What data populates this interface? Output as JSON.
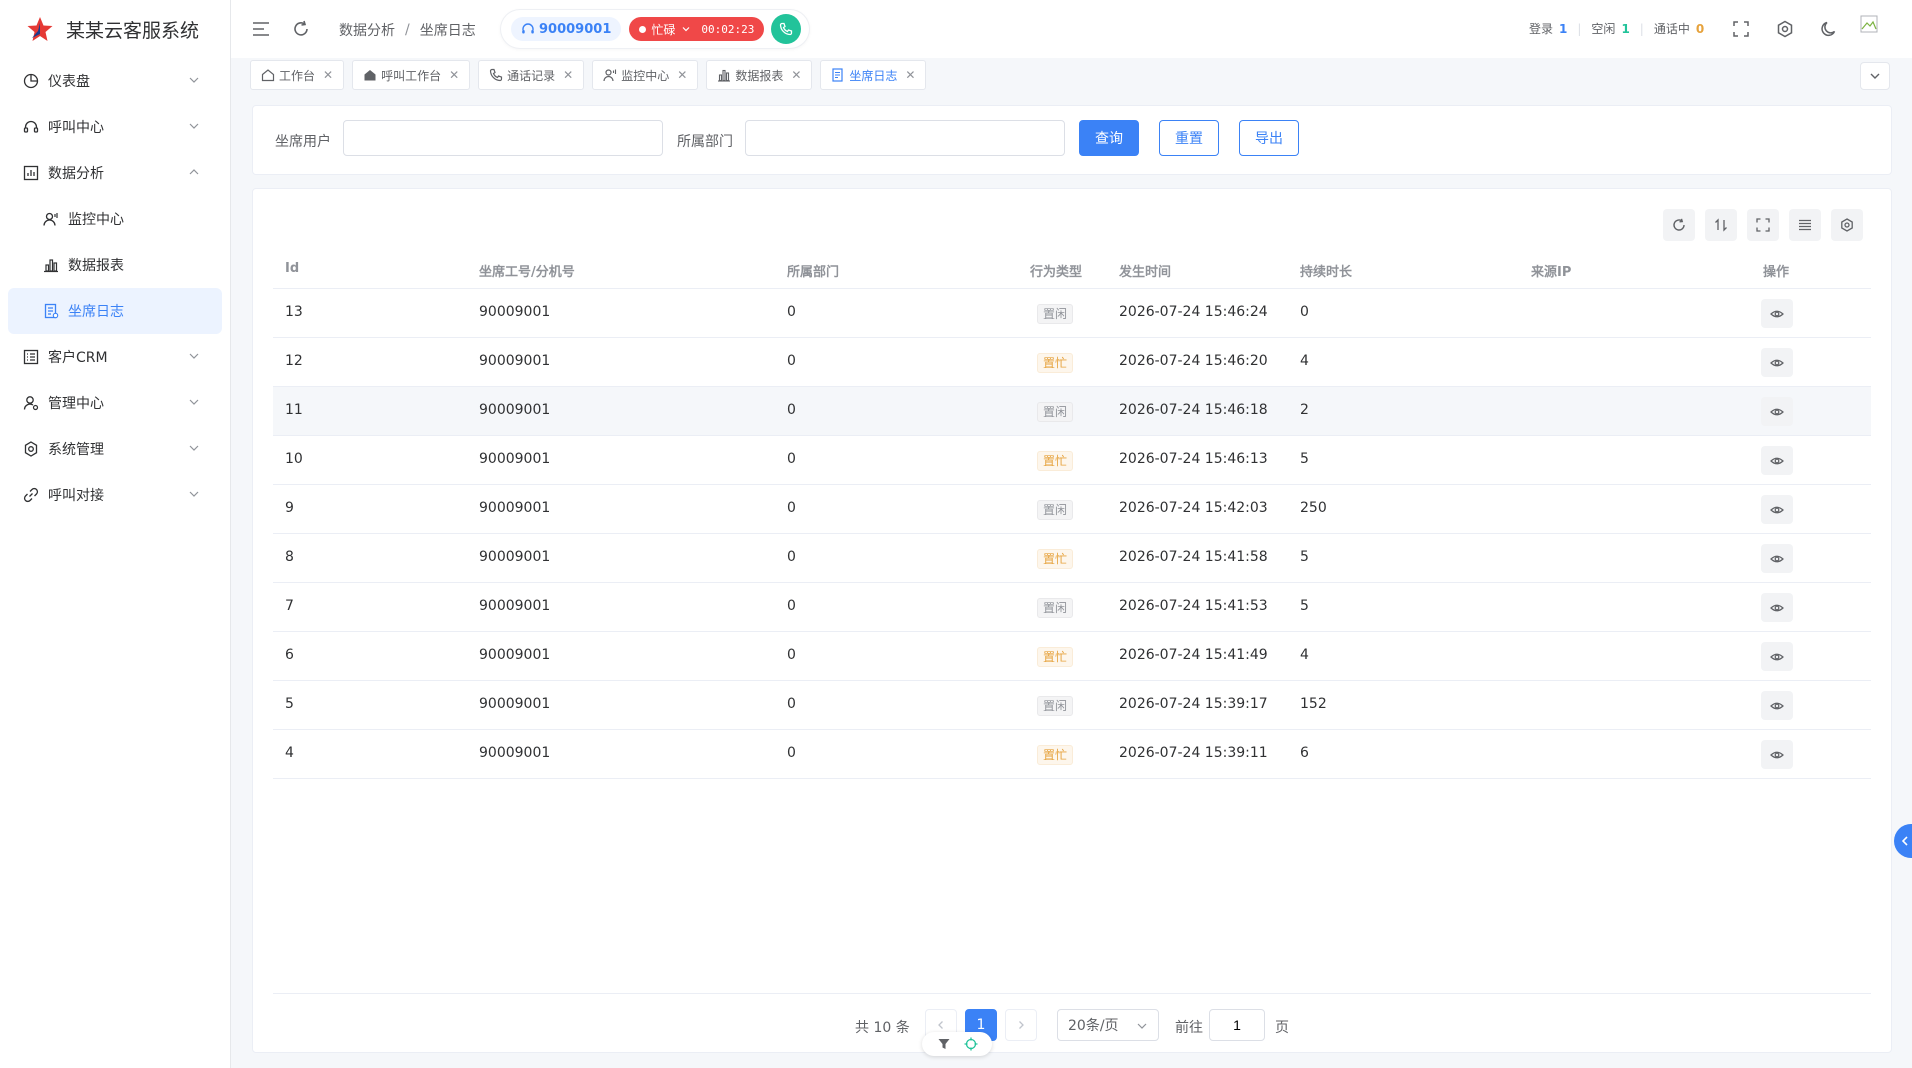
{
  "app": {
    "title": "某某云客服系统",
    "brand_color": "#e53935",
    "accent_color": "#3b82f6"
  },
  "sidebar": {
    "items": [
      {
        "label": "仪表盘",
        "icon": "pie-chart-icon",
        "expanded": false
      },
      {
        "label": "呼叫中心",
        "icon": "headset-icon",
        "expanded": false
      },
      {
        "label": "数据分析",
        "icon": "bar-chart-box-icon",
        "expanded": true
      },
      {
        "label": "客户CRM",
        "icon": "list-doc-icon",
        "expanded": false
      },
      {
        "label": "管理中心",
        "icon": "user-settings-icon",
        "expanded": false
      },
      {
        "label": "系统管理",
        "icon": "gear-icon",
        "expanded": false
      },
      {
        "label": "呼叫对接",
        "icon": "link-icon",
        "expanded": false
      }
    ],
    "subitems": [
      {
        "label": "监控中心",
        "icon": "monitor-user-icon"
      },
      {
        "label": "数据报表",
        "icon": "bar-chart-icon"
      },
      {
        "label": "坐席日志",
        "icon": "log-doc-icon",
        "active": true
      }
    ]
  },
  "header": {
    "breadcrumb": [
      "数据分析",
      "坐席日志"
    ],
    "extension": "90009001",
    "status": "忙碌",
    "timer": "00:02:23",
    "stats": {
      "login_label": "登录",
      "login_value": "1",
      "idle_label": "空闲",
      "idle_value": "1",
      "talking_label": "通话中",
      "talking_value": "0"
    }
  },
  "tabs": [
    {
      "label": "工作台",
      "icon": "home-icon",
      "active": false
    },
    {
      "label": "呼叫工作台",
      "icon": "home-fill-icon",
      "active": false
    },
    {
      "label": "通话记录",
      "icon": "phone-icon",
      "active": false
    },
    {
      "label": "监控中心",
      "icon": "monitor-user-icon",
      "active": false
    },
    {
      "label": "数据报表",
      "icon": "bar-chart-icon",
      "active": false
    },
    {
      "label": "坐席日志",
      "icon": "log-doc-icon",
      "active": true
    }
  ],
  "search": {
    "user_label": "坐席用户",
    "user_value": "",
    "dept_label": "所属部门",
    "dept_value": "",
    "query_label": "查询",
    "reset_label": "重置",
    "export_label": "导出"
  },
  "table": {
    "columns": [
      "Id",
      "坐席工号/分机号",
      "所属部门",
      "行为类型",
      "发生时间",
      "持续时长",
      "来源IP",
      "操作"
    ],
    "rows": [
      {
        "id": "13",
        "agent": "90009001",
        "dept": "0",
        "type": "置闲",
        "kind": "idle",
        "time": "2026-07-24 15:46:24",
        "duration": "0",
        "ip": ""
      },
      {
        "id": "12",
        "agent": "90009001",
        "dept": "0",
        "type": "置忙",
        "kind": "busy",
        "time": "2026-07-24 15:46:20",
        "duration": "4",
        "ip": ""
      },
      {
        "id": "11",
        "agent": "90009001",
        "dept": "0",
        "type": "置闲",
        "kind": "idle",
        "time": "2026-07-24 15:46:18",
        "duration": "2",
        "ip": ""
      },
      {
        "id": "10",
        "agent": "90009001",
        "dept": "0",
        "type": "置忙",
        "kind": "busy",
        "time": "2026-07-24 15:46:13",
        "duration": "5",
        "ip": ""
      },
      {
        "id": "9",
        "agent": "90009001",
        "dept": "0",
        "type": "置闲",
        "kind": "idle",
        "time": "2026-07-24 15:42:03",
        "duration": "250",
        "ip": ""
      },
      {
        "id": "8",
        "agent": "90009001",
        "dept": "0",
        "type": "置忙",
        "kind": "busy",
        "time": "2026-07-24 15:41:58",
        "duration": "5",
        "ip": ""
      },
      {
        "id": "7",
        "agent": "90009001",
        "dept": "0",
        "type": "置闲",
        "kind": "idle",
        "time": "2026-07-24 15:41:53",
        "duration": "5",
        "ip": ""
      },
      {
        "id": "6",
        "agent": "90009001",
        "dept": "0",
        "type": "置忙",
        "kind": "busy",
        "time": "2026-07-24 15:41:49",
        "duration": "4",
        "ip": ""
      },
      {
        "id": "5",
        "agent": "90009001",
        "dept": "0",
        "type": "置闲",
        "kind": "idle",
        "time": "2026-07-24 15:39:17",
        "duration": "152",
        "ip": ""
      },
      {
        "id": "4",
        "agent": "90009001",
        "dept": "0",
        "type": "置忙",
        "kind": "busy",
        "time": "2026-07-24 15:39:11",
        "duration": "6",
        "ip": ""
      }
    ]
  },
  "pagination": {
    "total_text": "共 10 条",
    "current_page": "1",
    "page_size": "20条/页",
    "goto_label": "前往",
    "goto_value": "1",
    "page_suffix": "页"
  }
}
